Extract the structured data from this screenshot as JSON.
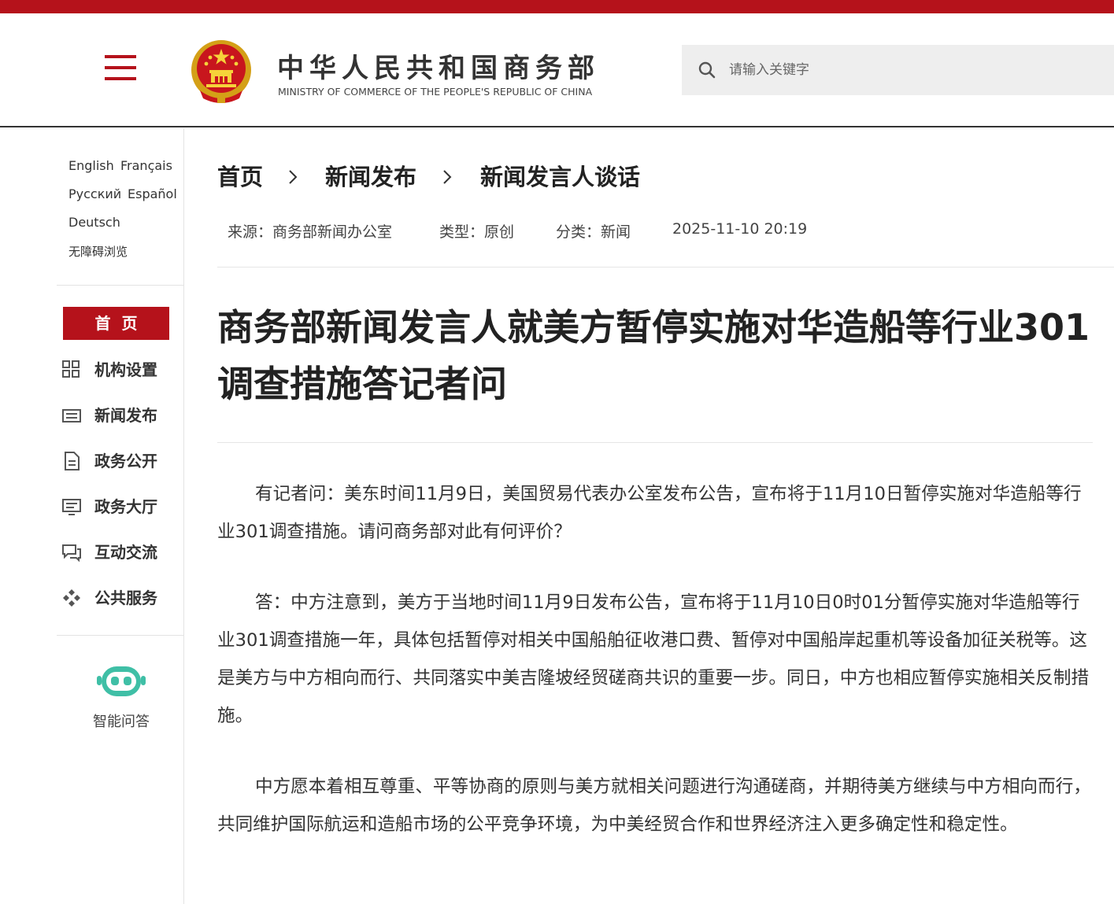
{
  "header": {
    "logo_cn": "中华人民共和国商务部",
    "logo_en": "MINISTRY OF COMMERCE OF THE PEOPLE'S REPUBLIC OF CHINA",
    "search_placeholder": "请输入关键字"
  },
  "languages": {
    "english": "English",
    "french": "Français",
    "russian": "Русский",
    "spanish": "Español",
    "german": "Deutsch",
    "accessible": "无障碍浏览"
  },
  "nav": {
    "home": "首页",
    "items": [
      {
        "label": "机构设置",
        "icon": "grid-icon"
      },
      {
        "label": "新闻发布",
        "icon": "news-icon"
      },
      {
        "label": "政务公开",
        "icon": "document-icon"
      },
      {
        "label": "政务大厅",
        "icon": "hall-icon"
      },
      {
        "label": "互动交流",
        "icon": "chat-icon"
      },
      {
        "label": "公共服务",
        "icon": "service-icon"
      }
    ],
    "assistant_label": "智能问答"
  },
  "breadcrumb": [
    "首页",
    "新闻发布",
    "新闻发言人谈话"
  ],
  "meta": {
    "source": "来源：商务部新闻办公室",
    "type": "类型：原创",
    "category": "分类：新闻",
    "datetime": "2025-11-10 20:19"
  },
  "article": {
    "title": "商务部新闻发言人就美方暂停实施对华造船等行业301调查措施答记者问",
    "paragraphs": [
      "有记者问：美东时间11月9日，美国贸易代表办公室发布公告，宣布将于11月10日暂停实施对华造船等行业301调查措施。请问商务部对此有何评价？",
      "答：中方注意到，美方于当地时间11月9日发布公告，宣布将于11月10日0时01分暂停实施对华造船等行业301调查措施一年，具体包括暂停对相关中国船舶征收港口费、暂停对中国船岸起重机等设备加征关税等。这是美方与中方相向而行、共同落实中美吉隆坡经贸磋商共识的重要一步。同日，中方也相应暂停实施相关反制措施。",
      "中方愿本着相互尊重、平等协商的原则与美方就相关问题进行沟通磋商，并期待美方继续与中方相向而行，共同维护国际航运和造船市场的公平竞争环境，为中美经贸合作和世界经济注入更多确定性和稳定性。"
    ]
  },
  "colors": {
    "brand_red": "#b5121b",
    "assistant_teal": "#3fbfa6"
  }
}
